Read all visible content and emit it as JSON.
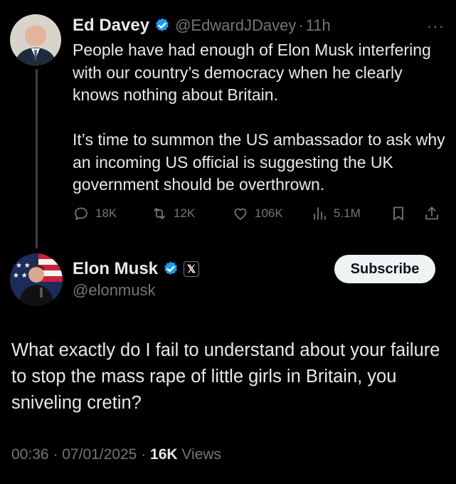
{
  "parent_tweet": {
    "display_name": "Ed Davey",
    "handle": "@EdwardJDavey",
    "separator": "·",
    "time": "11h",
    "more_label": "···",
    "paragraphs": [
      "People have had enough of Elon Musk interfering with our country’s democracy when he clearly knows nothing about Britain.",
      "It’s time to summon the US ambassador to ask why an incoming US official is suggesting the UK government should be overthrown."
    ],
    "actions": {
      "replies": "18K",
      "reposts": "12K",
      "likes": "106K",
      "views": "5.1M"
    }
  },
  "reply_tweet": {
    "display_name": "Elon Musk",
    "handle": "@elonmusk",
    "x_badge": "𝕏",
    "subscribe_label": "Subscribe",
    "text": "What exactly do I fail to understand about your failure to stop the mass rape of little girls in Britain, you sniveling cretin?",
    "time": "00:36",
    "sep1": "·",
    "date": "07/01/2025",
    "sep2": "·",
    "views_count": "16K",
    "views_label": "Views"
  },
  "colors": {
    "background": "#000000",
    "text": "#e7e9ea",
    "muted": "#71767b",
    "verified": "#1d9bf0",
    "subscribe_bg": "#eff3f4"
  },
  "icons": [
    "verified-badge-icon",
    "reply-icon",
    "repost-icon",
    "like-icon",
    "views-icon",
    "bookmark-icon",
    "share-icon",
    "x-logo-icon"
  ]
}
